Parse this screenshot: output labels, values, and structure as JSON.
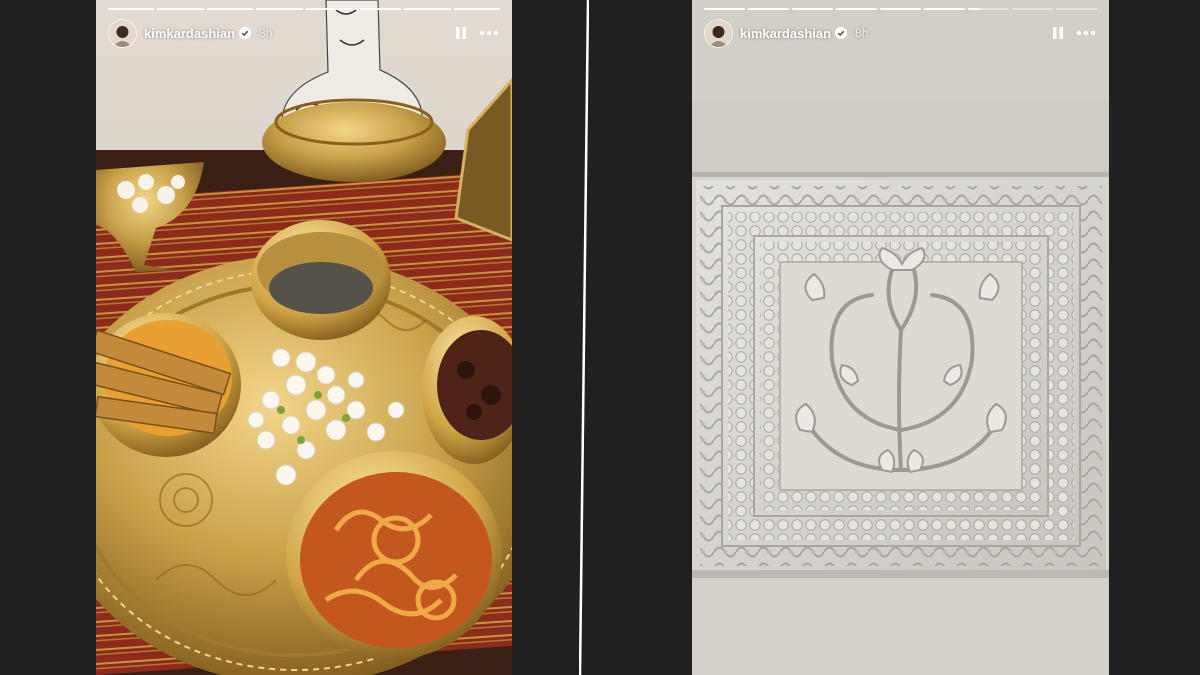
{
  "stories": [
    {
      "username": "kimkardashian",
      "time": "8h",
      "progress_total": 8,
      "progress_current": 8,
      "progress_current_fill": 1.0,
      "icons": {
        "avatar": "profile-avatar",
        "verified": "verified-badge-icon",
        "pause": "pause-icon",
        "more": "more-options-icon"
      }
    },
    {
      "username": "kimkardashian",
      "time": "8h",
      "progress_total": 9,
      "progress_current": 7,
      "progress_current_fill": 0.3,
      "icons": {
        "avatar": "profile-avatar",
        "verified": "verified-badge-icon",
        "pause": "pause-icon",
        "more": "more-options-icon"
      }
    }
  ],
  "colors": {
    "background": "#202020",
    "divider": "#ffffff",
    "brass": "#c9a24a",
    "marble": "#dcdad6"
  }
}
